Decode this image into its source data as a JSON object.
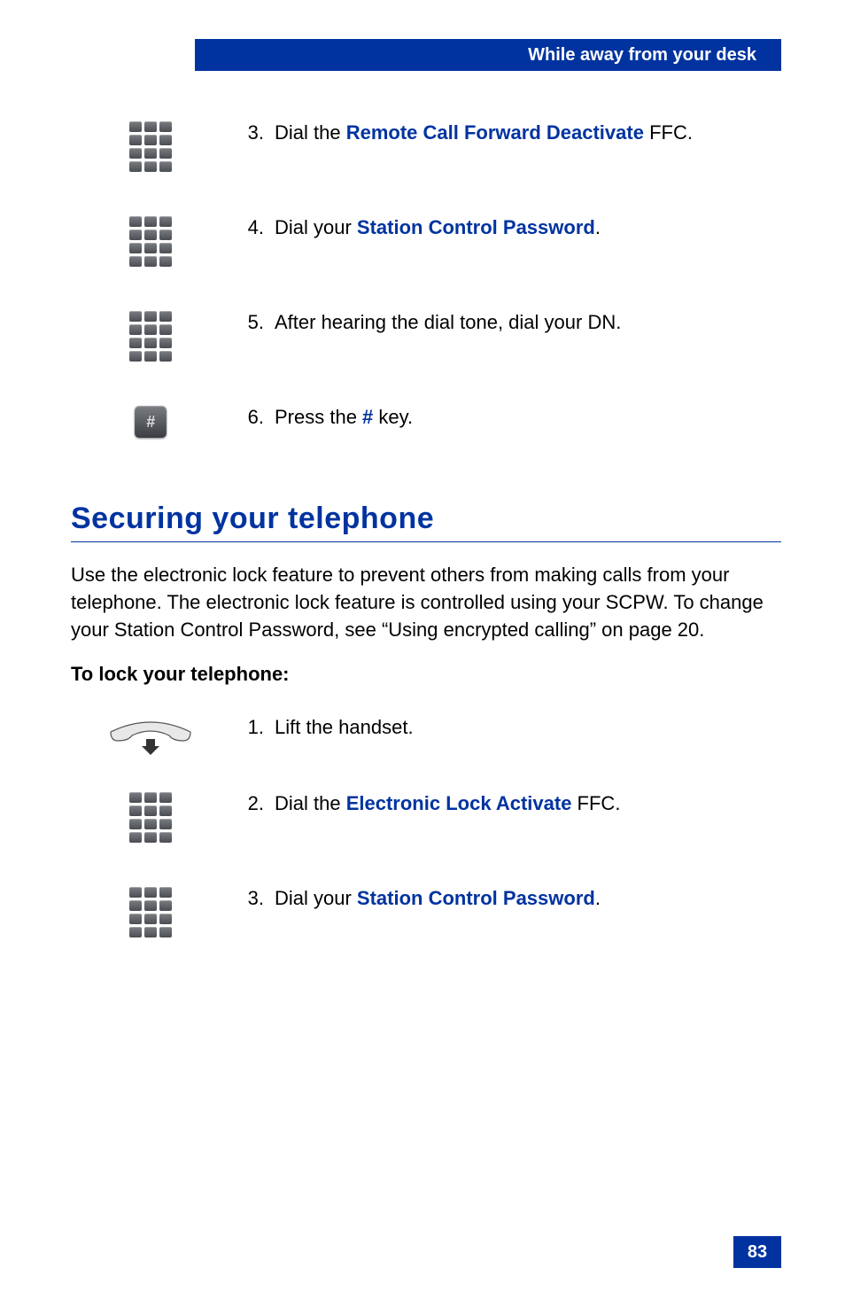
{
  "header": {
    "title": "While away from your desk"
  },
  "steps_top": [
    {
      "num": "3.",
      "pre": "Dial the ",
      "bold": "Remote Call Forward Deactivate",
      "post": " FFC."
    },
    {
      "num": "4.",
      "pre": "Dial your ",
      "bold": "Station Control Password",
      "post": "."
    },
    {
      "num": "5.",
      "pre": "",
      "bold": "",
      "post": "After hearing the dial tone, dial your DN."
    },
    {
      "num": "6.",
      "pre": "Press the ",
      "bold": "#",
      "post": " key."
    }
  ],
  "section": {
    "heading": "Securing your telephone",
    "paragraph": "Use the electronic lock feature to prevent others from making calls from your telephone. The electronic lock feature is controlled using your SCPW. To change your Station Control Password, see “Using encrypted calling” on page 20.",
    "subheading": "To lock your telephone:"
  },
  "steps_bottom": [
    {
      "num": "1.",
      "pre": "",
      "bold": "",
      "post": "Lift the handset."
    },
    {
      "num": "2.",
      "pre": "Dial the ",
      "bold": "Electronic Lock Activate",
      "post": " FFC."
    },
    {
      "num": "3.",
      "pre": "Dial your ",
      "bold": "Station Control Password",
      "post": "."
    }
  ],
  "page_number": "83"
}
